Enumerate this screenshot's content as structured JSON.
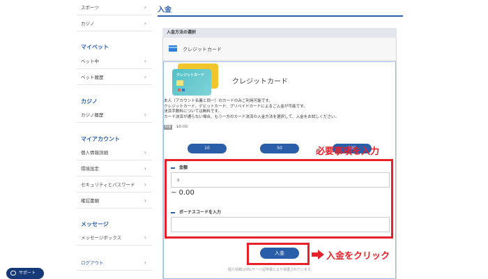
{
  "sidebar": {
    "items_top": [
      {
        "label": "スポーツ"
      },
      {
        "label": "カジノ"
      }
    ],
    "sections": [
      {
        "heading": "マイベット",
        "items": [
          {
            "label": "ベット中"
          },
          {
            "label": "ベット履歴"
          }
        ]
      },
      {
        "heading": "カジノ",
        "items": [
          {
            "label": "カジノ履歴"
          }
        ]
      },
      {
        "heading": "マイアカウント",
        "items": [
          {
            "label": "個人情報詳細"
          },
          {
            "label": "環境設定"
          },
          {
            "label": "セキュリティとパスワード"
          },
          {
            "label": "確認書類"
          }
        ]
      },
      {
        "heading": "メッセージ",
        "items": [
          {
            "label": "メッセージボックス"
          }
        ]
      }
    ],
    "logout": "ログアウト",
    "chevron": "›"
  },
  "main": {
    "title": "入金",
    "section_label": "入金方法の選択",
    "method_label": "クレジットカード",
    "card_art_label": "クレジットカード",
    "card_title": "クレジットカード",
    "desc_lines": [
      "本人（アカウント名義と同一）のカードのみご利用可能です。",
      "クレジットカード、デビットカード、プリペイドカードによるご入金が可能です。",
      "決済手数料については無料です。",
      "カード決済が通らない場合、もう一方のカード決済の入金方法を選択して、入金をお試しください。"
    ],
    "fee_badge": "料金",
    "fee_value": "$0.00",
    "amount_buttons": [
      "10",
      "50",
      "100"
    ],
    "amount_label": "金額",
    "amount_placeholder": "$",
    "approx": "~ 0.00",
    "bonus_label": "ボーナスコードを入力",
    "bonus_placeholder": "",
    "deposit_button": "入金",
    "footer_note": "個人情報はSSLサーバ証明書により保護されています。"
  },
  "annotations": {
    "required_text": "必要事項を入力",
    "click_text": "入金をクリック",
    "color": "#e8202a"
  },
  "support": {
    "label": "サポート"
  },
  "colors": {
    "accent": "#2a5ea8",
    "support_bg": "#163a78"
  }
}
